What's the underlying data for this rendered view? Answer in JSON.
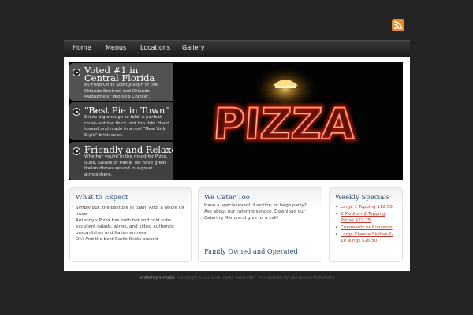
{
  "nav": {
    "items": [
      "Home",
      "Menus",
      "Locations",
      "Gallery"
    ]
  },
  "slides": [
    {
      "title": "Voted #1 in Central Florida",
      "text": "by Food Critic Scott Joseph of the Orlando Sentinel and Orlando Magazine's \"People's Choice\"."
    },
    {
      "title": "\"Best Pie in Town\"",
      "text": "Slices big enough to fold. A perfect crust--not too thick, not too thin. Hand tossed and made in a real \"New York Style\" brick oven."
    },
    {
      "title": "Friendly and Relaxed",
      "text": "Whether you're in the mood for Pizza, Subs, Salads or Pasta; we have great Italian dishes served in a great atmosphere."
    }
  ],
  "hero": {
    "sign": "PIZZA"
  },
  "expect": {
    "title": "What to Expect",
    "lines": [
      "Simply put, the best pie in town. And, a whole lot",
      "more!",
      "Anthony's Pizza has both hot and cold subs,",
      "excellent salads, wings, and sides, authentic",
      "pasta dishes and Italian entrees.",
      "Oh! And the best Garlic Knots around"
    ]
  },
  "cater": {
    "title": "We Cater Too!",
    "lines": [
      "Have a special event, function, or large party?",
      "Ask about our catering service. Download our",
      "Catering Menu and give us a call!"
    ],
    "title2": "Family Owned and Operated"
  },
  "specials": {
    "title": "Weekly Specials",
    "items": [
      [
        "Large 1 Topping $12.50"
      ],
      [
        "2 Medium 2 Topping",
        "Pizzas $22.75"
      ],
      [
        "Comments or Concerns"
      ],
      [
        "Large Cheese Sicilian &",
        "10 wings $26.50"
      ]
    ]
  },
  "footer": {
    "brand": "Anthony's Pizza",
    "text": " - Copyright © 2019 All Rights Reserved - This Website by Oak Brook Productions"
  },
  "colors": {
    "background": "#242424",
    "accent_title": "#274e75",
    "link": "#c0392b",
    "neon": "#ff3b1f",
    "rss": "#f08a24"
  },
  "icons": [
    "rss-icon",
    "play-icon"
  ]
}
